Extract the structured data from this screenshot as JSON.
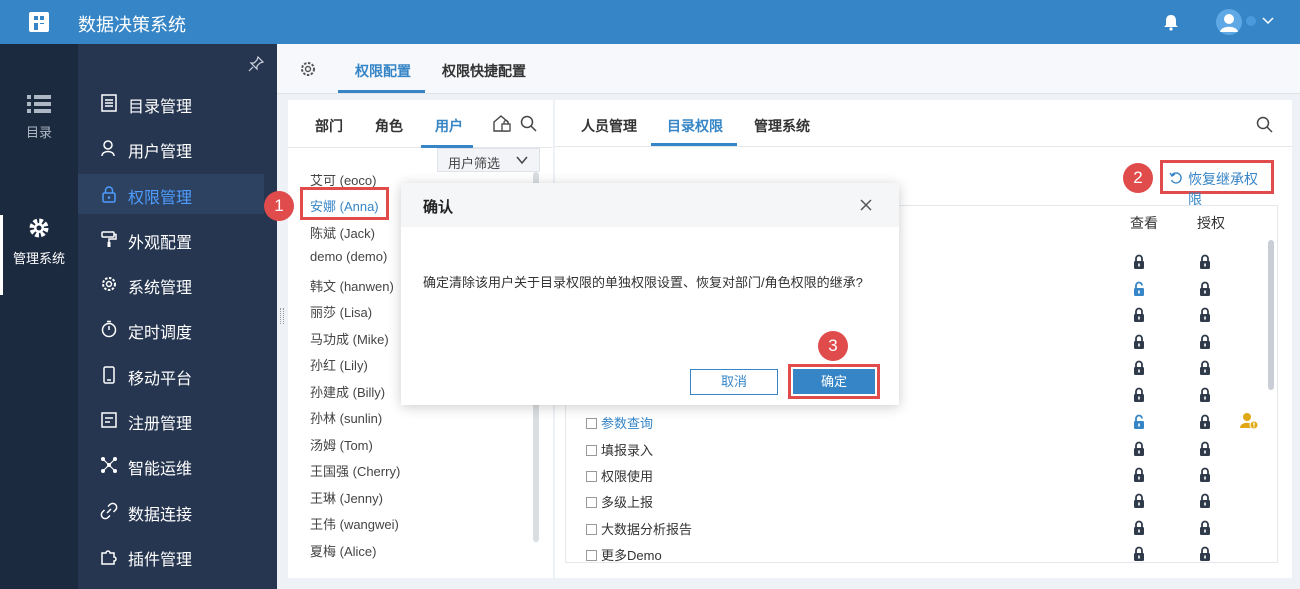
{
  "app": {
    "title": "数据决策系统"
  },
  "rail": [
    {
      "label": "目录",
      "icon": "list-icon"
    },
    {
      "label": "管理系统",
      "icon": "gear-icon"
    }
  ],
  "menu": [
    {
      "label": "目录管理",
      "icon": "catalog-icon"
    },
    {
      "label": "用户管理",
      "icon": "user-icon"
    },
    {
      "label": "权限管理",
      "icon": "lock-icon"
    },
    {
      "label": "外观配置",
      "icon": "paint-roller-icon"
    },
    {
      "label": "系统管理",
      "icon": "gear-icon"
    },
    {
      "label": "定时调度",
      "icon": "stopwatch-icon"
    },
    {
      "label": "移动平台",
      "icon": "mobile-icon"
    },
    {
      "label": "注册管理",
      "icon": "register-icon"
    },
    {
      "label": "智能运维",
      "icon": "network-icon"
    },
    {
      "label": "数据连接",
      "icon": "link-icon"
    },
    {
      "label": "插件管理",
      "icon": "puzzle-icon"
    }
  ],
  "top_tabs": [
    "权限配置",
    "权限快捷配置"
  ],
  "left_tabs": [
    "部门",
    "角色",
    "用户"
  ],
  "user_filter": "用户筛选",
  "users": [
    "艾可 (eoco)",
    "安娜 (Anna)",
    "陈斌 (Jack)",
    "demo (demo)",
    "韩文 (hanwen)",
    "丽莎 (Lisa)",
    "马功成 (Mike)",
    "孙红 (Lily)",
    "孙建成 (Billy)",
    "孙林 (sunlin)",
    "汤姆 (Tom)",
    "王国强 (Cherry)",
    "王琳 (Jenny)",
    "王伟 (wangwei)",
    "夏梅 (Alice)"
  ],
  "right_tabs": [
    "人员管理",
    "目录权限",
    "管理系统"
  ],
  "restore_label": "恢复继承权限",
  "columns": {
    "view": "查看",
    "grant": "授权"
  },
  "tree_rows": [
    "参数查询",
    "填报录入",
    "权限使用",
    "多级上报",
    "大数据分析报告",
    "更多Demo"
  ],
  "modal": {
    "title": "确认",
    "message": "确定清除该用户关于目录权限的单独权限设置、恢复对部门/角色权限的继承?",
    "cancel": "取消",
    "ok": "确定"
  },
  "markers": [
    "1",
    "2",
    "3"
  ],
  "colors": {
    "accent": "#3685c6",
    "highlight": "#e04b4b",
    "sidebar": "#263650"
  }
}
